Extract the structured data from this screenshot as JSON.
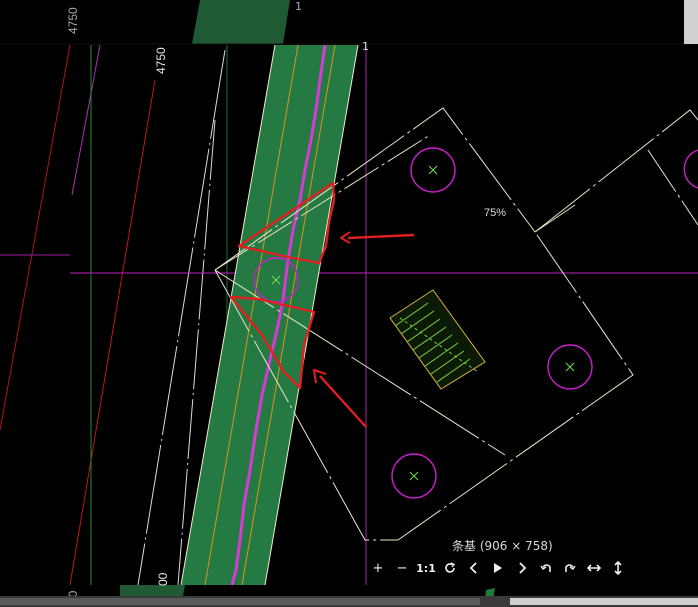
{
  "cad": {
    "dim_label_top": "4750",
    "dim_label_main": "4750",
    "dim_label_bottom": "00",
    "dim_label_left_bottom": "00",
    "marker_top": "1",
    "marker_mid": "1",
    "zoom_indicator": "75%"
  },
  "viewer": {
    "caption": "条基 (906 × 758)",
    "toolbar": {
      "zoom_in": "+",
      "zoom_out": "−",
      "actual_size": "1:1"
    }
  },
  "colors": {
    "background": "#000000",
    "strip_green": "#1f7a3a",
    "magenta": "#d63bd6",
    "annotation_red": "#e02020",
    "outline_white": "#e8e8d0",
    "hatch_green": "#7fd24a"
  },
  "icons": {
    "zoom_in": "plus-icon",
    "zoom_out": "minus-icon",
    "actual_size": "one-to-one-icon",
    "rotate": "rotate-icon",
    "prev": "chevron-left-icon",
    "play": "play-icon",
    "next": "chevron-right-icon",
    "undo": "undo-icon",
    "redo": "redo-icon",
    "fit_width": "fit-width-icon",
    "fit_height": "fit-height-icon"
  }
}
